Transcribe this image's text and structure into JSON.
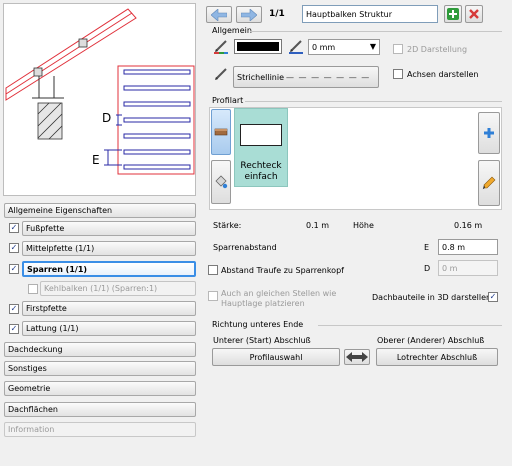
{
  "header": {
    "page_counter": "1/1",
    "structure_name": "Hauptbalken Struktur",
    "back_icon": "arrow-left-icon",
    "forward_icon": "arrow-right-icon",
    "add_icon": "plus-icon",
    "delete_icon": "close-icon"
  },
  "sidebar": {
    "items": [
      {
        "label": "Allgemeine Eigenschaften"
      },
      {
        "label": "Fußpfette"
      },
      {
        "label": "Mittelpfette (1/1)"
      },
      {
        "label": "Sparren (1/1)"
      },
      {
        "label": "Kehlbalken (1/1) (Sparren:1)"
      },
      {
        "label": "Firstpfette"
      },
      {
        "label": "Lattung (1/1)"
      },
      {
        "label": "Dachdeckung"
      },
      {
        "label": "Sonstiges"
      },
      {
        "label": "Geometrie"
      },
      {
        "label": "Dachflächen"
      },
      {
        "label": "Information"
      }
    ]
  },
  "preview": {
    "dim_d": "D",
    "dim_e": "E"
  },
  "allgemein": {
    "title": "Allgemein",
    "line_weight": "0 mm",
    "line_style": "Strichellinie",
    "dash_pattern": "— — — — — — —",
    "cb_2d": "2D Darstellung",
    "cb_axes": "Achsen darstellen"
  },
  "profilart": {
    "title": "Profilart",
    "tile_label": "Rechteck einfach"
  },
  "props": {
    "staerke_label": "Stärke:",
    "staerke_value": "0.1 m",
    "hoehe_label": "Höhe",
    "hoehe_value": "0.16 m",
    "sparrenabstand_label": "Sparrenabstand",
    "e_label": "E",
    "e_value": "0.8 m",
    "abstand_traufe_label": "Abstand Traufe zu Sparrenkopf",
    "d_label": "D",
    "d_value": "0 m",
    "auch_label": "Auch an gleichen Stellen wie Hauptlage platzieren",
    "dachbauteile_label": "Dachbauteile in 3D darstellen"
  },
  "richtung": {
    "title": "Richtung unteres Ende",
    "unterer_label": "Unterer (Start) Abschluß",
    "oberer_label": "Oberer (Anderer) Abschluß",
    "profilauswahl_btn": "Profilauswahl",
    "lotrechter_btn": "Lotrechter Abschluß"
  },
  "colors": {
    "accent_blue": "#2f7fd6",
    "green": "#2e9b3a",
    "red": "#d63a3a",
    "tile_bg": "#a9ddd5",
    "preview_red": "#e0313b",
    "preview_blue": "#2a2aa6"
  }
}
